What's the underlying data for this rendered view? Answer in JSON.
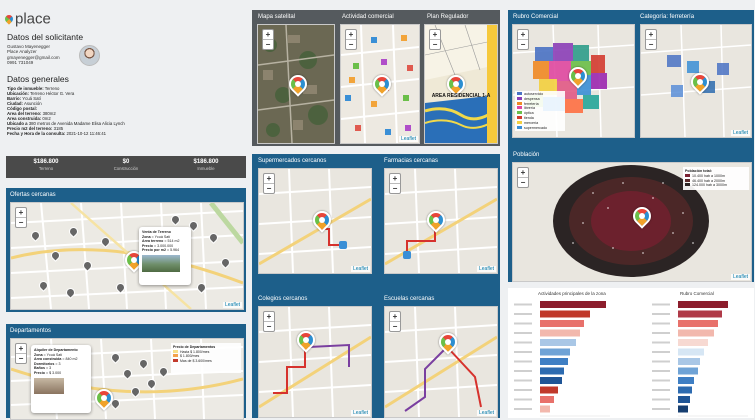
{
  "brand": {
    "name": "place"
  },
  "solicitante": {
    "heading": "Datos del solicitante",
    "lines": [
      "Gustavo Mayenegger",
      "Place Analyzer",
      "gmayenegger@gmail.com",
      "0991 731049"
    ]
  },
  "generales": {
    "heading": "Datos generales",
    "rows": [
      {
        "k": "Tipo de inmueble:",
        "v": " Terreno"
      },
      {
        "k": "Ubicación:",
        "v": " Terreno Héctor G. Vera"
      },
      {
        "k": "Barrio:",
        "v": " Ycuá Satí"
      },
      {
        "k": "Ciudad:",
        "v": " Asunción"
      },
      {
        "k": "Código postal:",
        "v": ""
      },
      {
        "k": "Area del terreno:",
        "v": " 380m2"
      },
      {
        "k": "Area construida:",
        "v": " 0m2"
      },
      {
        "k": "Ubicado a",
        "v": " 380 metros de Avenida Madame Elisa Alicia Lynch"
      },
      {
        "k": "Precio m2 del terreno:",
        "v": " 3185"
      },
      {
        "k": "Fecha y Hora de la consulta:",
        "v": " 2021-10-12 11:46:41"
      }
    ]
  },
  "valuation": {
    "cells": [
      {
        "value": "$186.800",
        "label": "Terreno"
      },
      {
        "value": "$0",
        "label": "Construcción"
      },
      {
        "value": "$186.800",
        "label": "Inmueble"
      }
    ]
  },
  "ofertas": {
    "title": "Ofertas cercanas",
    "popup": [
      {
        "k": "Venta de Terreno",
        "v": ""
      },
      {
        "k": "Zona",
        "v": " = Ycuá Satí"
      },
      {
        "k": "Area terreno",
        "v": " = 514 m2"
      },
      {
        "k": "Precio",
        "v": " = 3.000.000"
      },
      {
        "k": "Precio por m2",
        "v": " = 5.964"
      }
    ],
    "leaflet": "Leaflet"
  },
  "departamentos": {
    "title": "Departamentos",
    "popup": [
      {
        "k": "Alquiler de Departamento",
        "v": ""
      },
      {
        "k": "Zona",
        "v": " = Ycuá Satí"
      },
      {
        "k": "Area construida",
        "v": " = 840 m2"
      },
      {
        "k": "Dormitorios",
        "v": " = 3"
      },
      {
        "k": "Baños",
        "v": " = 3"
      },
      {
        "k": "Precio",
        "v": " = $ 3.000"
      }
    ],
    "legend": {
      "title": "Precio de Departamentos",
      "items": [
        "Hasta $ 1.800/mes",
        "$ 1.800/mes",
        "Mas de $ 3.600/mes"
      ]
    }
  },
  "topmaps": {
    "titles": [
      "Mapa satelital",
      "Actividad comercial",
      "Plan Regulador"
    ],
    "plan_label": "AREA RESIDENCIAL 1-A"
  },
  "midmaps": {
    "titles": [
      "Supermercados cercanos",
      "Farmacias cercanas",
      "Colegios cercanos",
      "Escuelas cercanas"
    ]
  },
  "rubro": {
    "titles": [
      "Rubro Comercial",
      "Categoría: ferretería"
    ],
    "legend": [
      "autoservicio",
      "despensa",
      "ferretería",
      "librería",
      "óptica",
      "tienda",
      "mercería",
      "supermercado"
    ]
  },
  "poblacion": {
    "title": "Población",
    "legend": {
      "title": "Población total:",
      "items": [
        "10.400 hab a 1000m",
        "46.400 hab a 2000m",
        "124.000 hab a 3000m"
      ]
    }
  },
  "charts": {
    "left_title": "Actividades principales de la zona",
    "right_title": "Rubro Comercial",
    "left_labels": [
      "",
      "",
      "",
      "",
      "",
      "",
      "",
      "",
      "",
      "",
      "",
      ""
    ],
    "right_labels": [
      "",
      "",
      "",
      "",
      "",
      "",
      "",
      "",
      "",
      "",
      "",
      ""
    ]
  },
  "zoom": {
    "plus": "+",
    "minus": "−"
  },
  "attribution": "Leaflet",
  "colors": {
    "dark_panel": "#555a5e",
    "blue_panel": "#1d5f8a",
    "valuation_bar": "#4a4a4a"
  }
}
